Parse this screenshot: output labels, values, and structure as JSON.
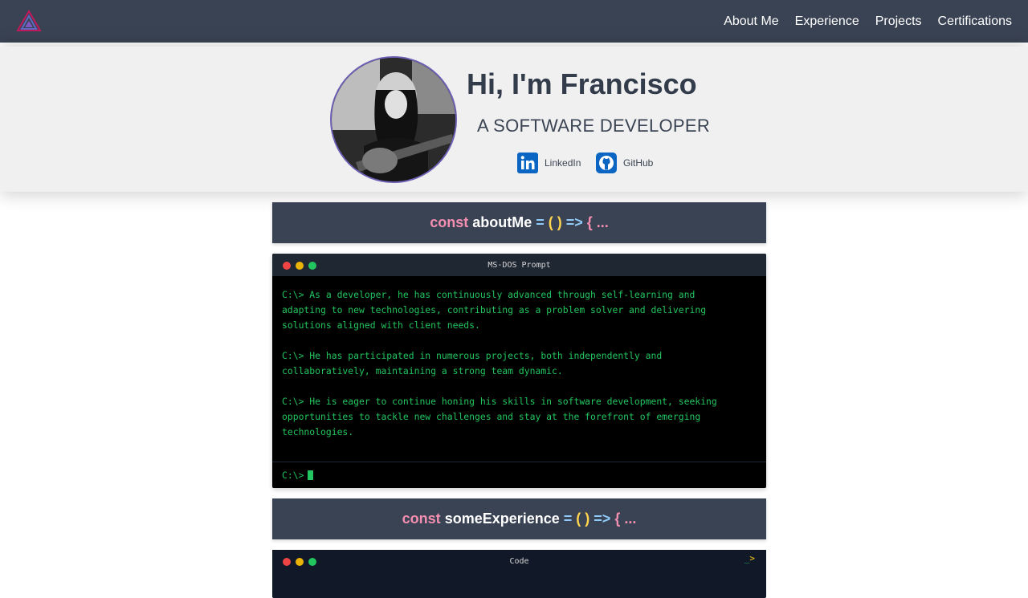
{
  "nav": {
    "items": [
      "About Me",
      "Experience",
      "Projects",
      "Certifications"
    ]
  },
  "hero": {
    "title": "Hi, I'm Francisco",
    "subtitle": "A SOFTWARE DEVELOPER",
    "links": {
      "linkedin": "LinkedIn",
      "github": "GitHub"
    }
  },
  "about": {
    "header": {
      "kw": "const",
      "name": "aboutMe",
      "eq": "=",
      "paren": "( )",
      "arrow": "=>",
      "brace": "{ ..."
    },
    "terminal_title": "MS-DOS Prompt",
    "paragraphs": [
      [
        "C:\\> As a developer, he has continuously advanced through self-learning and",
        "adapting to new technologies, contributing as a problem solver and delivering",
        "solutions aligned with client needs."
      ],
      [
        "C:\\> He has participated in numerous projects, both independently and",
        "collaboratively, maintaining a strong team dynamic."
      ],
      [
        "C:\\> He is eager to continue honing his skills in software development, seeking",
        "opportunities to tackle new challenges and stay at the forefront of emerging",
        "technologies."
      ]
    ],
    "prompt": "C:\\>"
  },
  "experience": {
    "header": {
      "kw": "const",
      "name": "someExperience",
      "eq": "=",
      "paren": "( )",
      "arrow": "=>",
      "brace": "{ ..."
    },
    "window_title": "Code",
    "prompt_underscore": "_",
    "prompt_gt": ">"
  },
  "colors": {
    "navbar": "#3a4353",
    "keyword": "#f48fb1",
    "terminal_text": "#22c55e",
    "paren": "#ffd54f",
    "operator": "#90caf9"
  }
}
